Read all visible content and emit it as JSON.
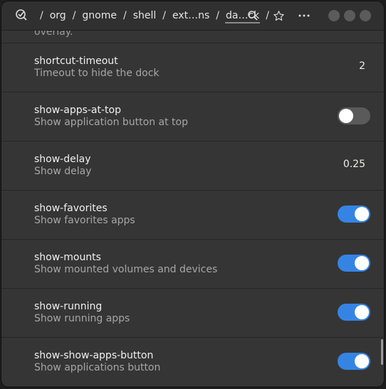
{
  "header": {
    "path": [
      "org",
      "gnome",
      "shell",
      "ext…ns",
      "da…ck"
    ],
    "icons": {
      "app": "dconf-editor-icon",
      "search": "search-icon",
      "bookmark": "star-icon",
      "menu": "more-icon"
    }
  },
  "partial_row_text": "overlay.",
  "rows": [
    {
      "key": "shortcut-timeout",
      "desc": "Timeout to hide the dock",
      "value": "2"
    },
    {
      "key": "show-apps-at-top",
      "desc": "Show application button at top",
      "toggle": false
    },
    {
      "key": "show-delay",
      "desc": "Show delay",
      "value": "0.25"
    },
    {
      "key": "show-favorites",
      "desc": "Show favorites apps",
      "toggle": true
    },
    {
      "key": "show-mounts",
      "desc": "Show mounted volumes and devices",
      "toggle": true
    },
    {
      "key": "show-running",
      "desc": "Show running apps",
      "toggle": true
    },
    {
      "key": "show-show-apps-button",
      "desc": "Show applications button",
      "toggle": true
    }
  ],
  "colors": {
    "accent": "#3584e4",
    "switch_off": "#5a5a5a",
    "background": "#353535"
  }
}
